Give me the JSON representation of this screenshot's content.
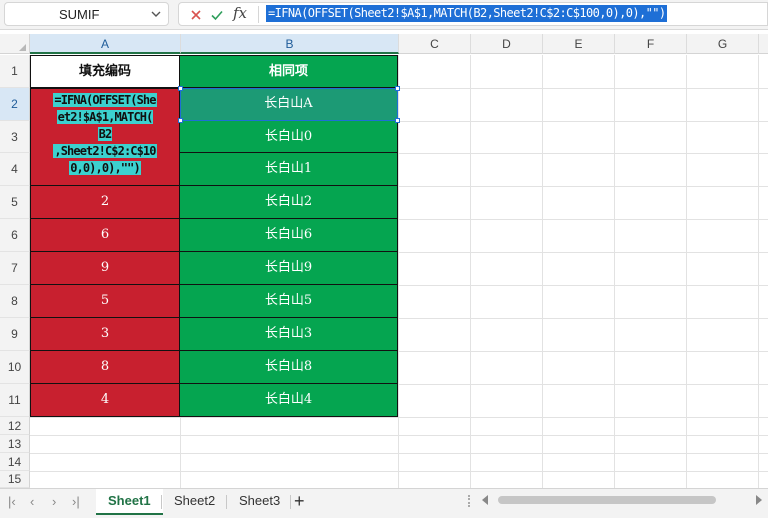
{
  "formula_bar": {
    "name_box": "SUMIF",
    "fx_label": "fx",
    "formula": "=IFNA(OFFSET(Sheet2!$A$1,MATCH(B2,Sheet2!C$2:C$100,0),0),\"\")"
  },
  "columns": [
    "A",
    "B",
    "C",
    "D",
    "E",
    "F",
    "G"
  ],
  "rows": [
    "1",
    "2",
    "3",
    "4",
    "5",
    "6",
    "7",
    "8",
    "9",
    "10",
    "11",
    "12",
    "13",
    "14",
    "15"
  ],
  "cells": {
    "a1": "填充编码",
    "b1": "相同项",
    "a2_lines": [
      "=IFNA(OFFSET(She",
      "et2!$A$1,MATCH(",
      "B2",
      ",Sheet2!C$2:C$10",
      "0,0),0),\"\")"
    ],
    "a_values": [
      "2",
      "6",
      "9",
      "5",
      "3",
      "8",
      "4"
    ],
    "b_values": [
      "长白山A",
      "长白山0",
      "长白山1",
      "长白山2",
      "长白山6",
      "长白山9",
      "长白山5",
      "长白山3",
      "长白山8",
      "长白山4"
    ]
  },
  "sheets": [
    "Sheet1",
    "Sheet2",
    "Sheet3"
  ],
  "active_sheet": "Sheet1",
  "add_sheet_label": "+",
  "colors": {
    "column_a_fill": "#c8202f",
    "column_b_fill": "#05a550",
    "selected_cell_fill": "#1c9a75",
    "formula_highlight": "#3cd1cf",
    "selection_blue": "#1e6fd6",
    "active_tab": "#217346"
  }
}
